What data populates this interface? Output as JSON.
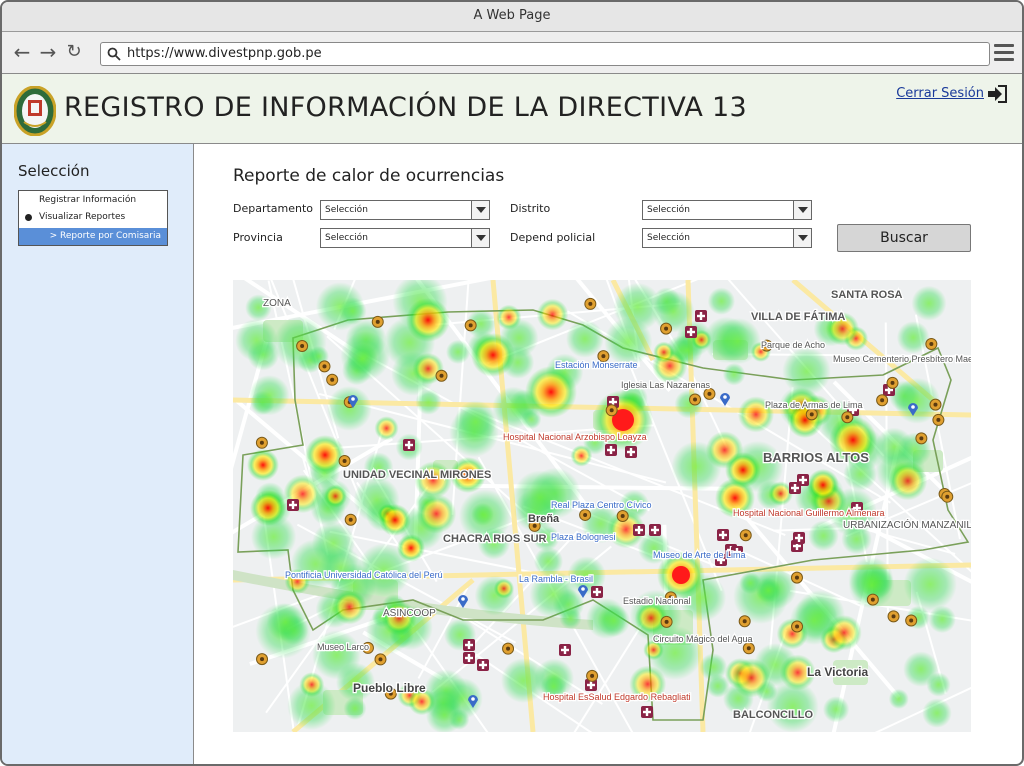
{
  "browser": {
    "window_title": "A Web Page",
    "url": "https://www.divestpnp.gob.pe"
  },
  "header": {
    "title": "REGISTRO DE INFORMACIÓN DE LA DIRECTIVA 13",
    "logout_label": "Cerrar Sesión"
  },
  "sidebar": {
    "title": "Selección",
    "items": [
      {
        "label": "Registrar Información"
      },
      {
        "label": "Visualizar Reportes"
      },
      {
        "label": "> Reporte por Comisaria"
      }
    ]
  },
  "main": {
    "title": "Reporte de calor de ocurrencias",
    "filters": {
      "departamento": {
        "label": "Departamento",
        "value": "Selección"
      },
      "provincia": {
        "label": "Provincia",
        "value": "Selección"
      },
      "distrito": {
        "label": "Distrito",
        "value": "Selección"
      },
      "depend": {
        "label": "Depend policial",
        "value": "Selección"
      }
    },
    "search_label": "Buscar"
  },
  "map": {
    "labels": [
      {
        "text": "SANTA ROSA",
        "size": 11,
        "color": "#555"
      },
      {
        "text": "VILLA DE FÁTIMA",
        "size": 11,
        "color": "#555"
      },
      {
        "text": "Parque de Acho",
        "size": 9,
        "color": "#555"
      },
      {
        "text": "Museo Cementerio Presbítero Maestro",
        "size": 9,
        "color": "#555"
      },
      {
        "text": "Estación Monserrate",
        "size": 9,
        "color": "#3a6bc8"
      },
      {
        "text": "Iglesia Las Nazarenas",
        "size": 9,
        "color": "#555"
      },
      {
        "text": "Plaza de Armas de Lima",
        "size": 9,
        "color": "#555"
      },
      {
        "text": "Hospital Nacional Arzobispo Loayza",
        "size": 9,
        "color": "#c0392b"
      },
      {
        "text": "UNIDAD VECINAL MIRONES",
        "size": 11,
        "color": "#555"
      },
      {
        "text": "BARRIOS ALTOS",
        "size": 13,
        "color": "#555"
      },
      {
        "text": "Real Plaza Centro Cívico",
        "size": 9,
        "color": "#3a6bc8"
      },
      {
        "text": "Breña",
        "size": 11,
        "color": "#444"
      },
      {
        "text": "CHACRA RIOS SUR",
        "size": 11,
        "color": "#555"
      },
      {
        "text": "Plaza Bolognesi",
        "size": 9,
        "color": "#3a6bc8"
      },
      {
        "text": "Hospital Nacional Guillermo Almenara",
        "size": 9,
        "color": "#c0392b"
      },
      {
        "text": "URBANIZACIÓN MANZANILLA",
        "size": 10,
        "color": "#555"
      },
      {
        "text": "Museo de Arte de Lima",
        "size": 9,
        "color": "#3a6bc8"
      },
      {
        "text": "La Rambla - Brasil",
        "size": 9,
        "color": "#3a6bc8"
      },
      {
        "text": "Estadio Nacional",
        "size": 9,
        "color": "#555"
      },
      {
        "text": "Pontificia Universidad Católica del Perú",
        "size": 9,
        "color": "#3a6bc8"
      },
      {
        "text": "Museo Larco",
        "size": 9,
        "color": "#555"
      },
      {
        "text": "Circuito Mágico del Agua",
        "size": 9,
        "color": "#555"
      },
      {
        "text": "Pueblo Libre",
        "size": 12,
        "color": "#444"
      },
      {
        "text": "La Victoria",
        "size": 12,
        "color": "#444"
      },
      {
        "text": "Hospital EsSalud Edgardo Rebagliati",
        "size": 9,
        "color": "#c0392b"
      },
      {
        "text": "BALCONCILLO",
        "size": 11,
        "color": "#555"
      },
      {
        "text": "ZONA",
        "size": 10,
        "color": "#555"
      },
      {
        "text": "ASINCOOP",
        "size": 10,
        "color": "#555"
      }
    ]
  }
}
